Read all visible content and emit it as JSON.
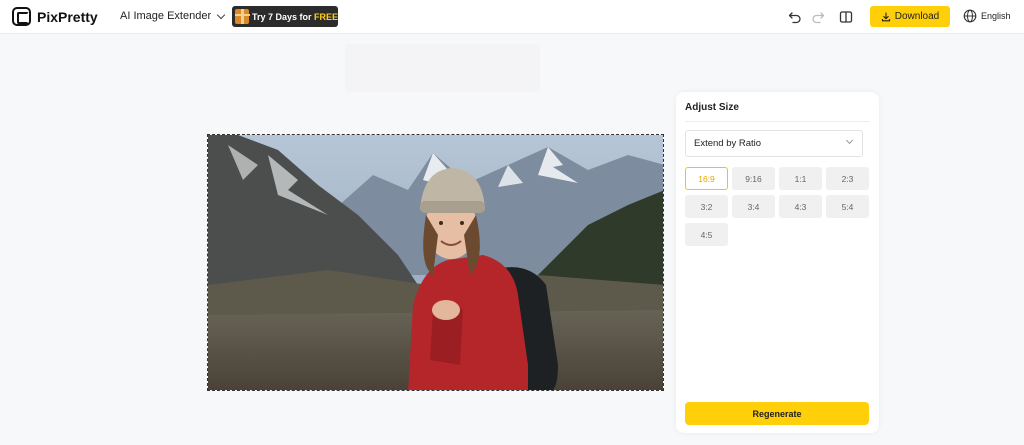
{
  "header": {
    "brand": "PixPretty",
    "tool_menu": "AI Image Extender",
    "promo": {
      "prefix": "Try 7 Days for ",
      "highlight": "FREE"
    },
    "download_label": "Download",
    "language": "English",
    "icons": [
      "undo-icon",
      "redo-icon",
      "compare-icon",
      "download-icon",
      "globe-icon"
    ]
  },
  "panel": {
    "title": "Adjust Size",
    "mode": "Extend by Ratio",
    "ratios": [
      "16:9",
      "9:16",
      "1:1",
      "2:3",
      "3:2",
      "3:4",
      "4:3",
      "5:4",
      "4:5"
    ],
    "selected_ratio": "16:9",
    "regenerate_label": "Regenerate"
  },
  "colors": {
    "accent": "#ffcf0a",
    "active_border": "#f4c400",
    "promo_bg": "#2b2b2b"
  }
}
